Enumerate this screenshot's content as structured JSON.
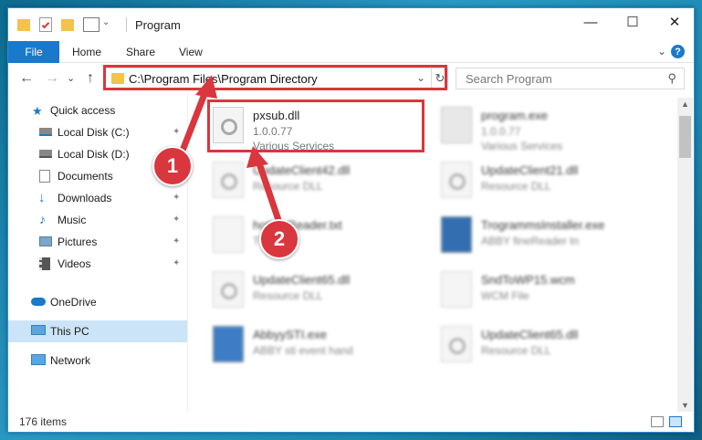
{
  "window": {
    "title": "Program",
    "minimize_glyph": "—",
    "maximize_glyph": "☐",
    "close_glyph": "✕"
  },
  "ribbon": {
    "tabs": [
      "File",
      "Home",
      "Share",
      "View"
    ],
    "expand_glyph": "⌄",
    "help_glyph": "?"
  },
  "nav": {
    "back_glyph": "←",
    "forward_glyph": "→",
    "recent_glyph": "⌄",
    "up_glyph": "↑"
  },
  "address": {
    "path": "C:\\Program Files\\Program Directory",
    "dropdown_glyph": "⌄",
    "refresh_glyph": "↻"
  },
  "search": {
    "placeholder": "Search Program",
    "icon_glyph": "⚲"
  },
  "sidebar": {
    "items": [
      {
        "label": "Quick access",
        "icon": "star-icon",
        "pinned": false
      },
      {
        "label": "Local Disk (C:)",
        "icon": "drive-icon",
        "pinned": true
      },
      {
        "label": "Local Disk (D:)",
        "icon": "drive-icon",
        "pinned": true
      },
      {
        "label": "Documents",
        "icon": "documents-icon",
        "pinned": true
      },
      {
        "label": "Downloads",
        "icon": "download-icon",
        "pinned": true
      },
      {
        "label": "Music",
        "icon": "music-icon",
        "pinned": true
      },
      {
        "label": "Pictures",
        "icon": "pictures-icon",
        "pinned": true
      },
      {
        "label": "Videos",
        "icon": "videos-icon",
        "pinned": true
      },
      {
        "label": "OneDrive",
        "icon": "cloud-icon",
        "pinned": false
      },
      {
        "label": "This PC",
        "icon": "computer-icon",
        "pinned": false,
        "selected": true
      },
      {
        "label": "Network",
        "icon": "network-icon",
        "pinned": false
      }
    ],
    "pin_glyph": "📌"
  },
  "files": [
    {
      "name": "pxsub.dll",
      "line1": "1.0.0.77",
      "line2": "Various Services",
      "icon": "dll-file-icon",
      "highlighted": true
    },
    {
      "name": "program.exe",
      "line1": "1.0.0.77",
      "line2": "Various Services",
      "icon": "exe-file-icon"
    },
    {
      "name": "UpdateClient42.dll",
      "line1": "Resource DLL",
      "line2": "",
      "icon": "dll-file-icon"
    },
    {
      "name": "UpdateClient21.dll",
      "line1": "Resource DLL",
      "line2": "",
      "icon": "dll-file-icon"
    },
    {
      "name": "hotlineReader.txt",
      "line1": "T",
      "line2": "",
      "icon": "txt-file-icon"
    },
    {
      "name": "TrogrammsInstaller.exe",
      "line1": "ABBY fineReader tn",
      "line2": "",
      "icon": "installer-icon"
    },
    {
      "name": "UpdateClient65.dll",
      "line1": "Resource DLL",
      "line2": "",
      "icon": "dll-file-icon"
    },
    {
      "name": "SndToWP15.wcm",
      "line1": "WCM File",
      "line2": "",
      "icon": "wcm-file-icon"
    },
    {
      "name": "AbbyySTI.exe",
      "line1": "ABBY sti event hand",
      "line2": "",
      "icon": "exe-file-icon"
    },
    {
      "name": "UpdateClient65.dll",
      "line1": "Resource DLL",
      "line2": "",
      "icon": "dll-file-icon"
    }
  ],
  "status": {
    "item_count": "176 items"
  },
  "annotations": {
    "callout_1": "1",
    "callout_2": "2"
  },
  "colors": {
    "accent": "#1979ca",
    "annotation_red": "#d9363e",
    "selected_bg": "#cce4f7",
    "folder": "#f5c24a"
  }
}
